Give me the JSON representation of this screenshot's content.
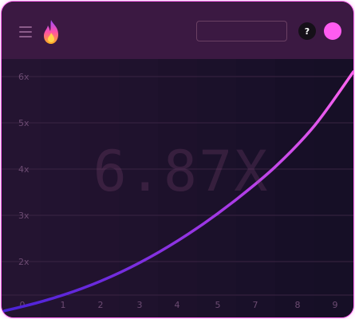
{
  "header": {
    "search_value": "",
    "help_label": "?",
    "menu_icon": "hamburger-menu-icon",
    "logo_icon": "flame-logo-icon",
    "avatar_color": "#ff5cf0"
  },
  "game": {
    "multiplier": "6.87X"
  },
  "colors": {
    "curve_start": "#4a22d8",
    "curve_end": "#ff66f0",
    "border": "#ff66f0",
    "header_bg": "#3b1942"
  },
  "chart_data": {
    "type": "line",
    "y_tick_labels": [
      "6x",
      "5x",
      "4x",
      "3x",
      "2x"
    ],
    "x_tick_labels": [
      "0",
      "1",
      "2",
      "3",
      "4",
      "5",
      "7",
      "8",
      "9"
    ],
    "series": [
      {
        "x": [
          0,
          1,
          2,
          3,
          4,
          5,
          6,
          7,
          8,
          9
        ],
        "y": [
          1.0,
          1.24,
          1.55,
          1.95,
          2.45,
          3.05,
          3.75,
          4.55,
          5.55,
          6.87
        ]
      }
    ],
    "xlim": [
      0,
      9
    ],
    "ylim": [
      1,
      6.87
    ],
    "grid": true
  }
}
